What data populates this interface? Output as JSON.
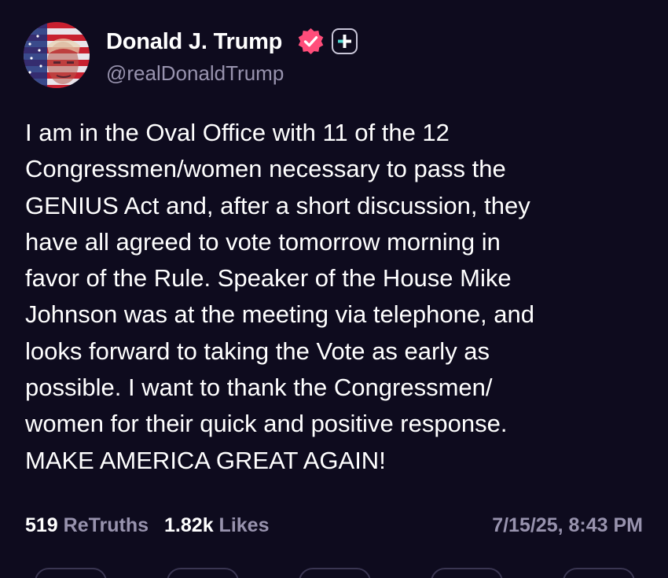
{
  "author": {
    "name": "Donald J. Trump",
    "handle": "@realDonaldTrump",
    "verified_badge_color": "#ff4d7a",
    "plus_badge_color": "#4fd8d0"
  },
  "post": {
    "lines": [
      "I am in the Oval Office with 11 of the 12",
      "Congressmen/women necessary to pass the",
      "GENIUS Act and, after a short discussion, they",
      "have all agreed to vote tomorrow morning in",
      "favor of the Rule. Speaker of the House Mike",
      "Johnson was at the meeting via telephone, and",
      "looks forward to taking the Vote as early as",
      "possible. I want to thank the Congressmen/",
      "women for their quick and positive response.",
      "MAKE AMERICA GREAT AGAIN!"
    ]
  },
  "stats": {
    "retruths_count": "519",
    "retruths_label": "ReTruths",
    "likes_count": "1.82k",
    "likes_label": "Likes"
  },
  "timestamp": "7/15/25, 8:43 PM",
  "icons": {
    "verified": "verified-check-icon",
    "plus": "plus-icon"
  },
  "theme": {
    "background": "#0e0b1e",
    "text": "#ffffff",
    "muted": "#9893ae"
  }
}
